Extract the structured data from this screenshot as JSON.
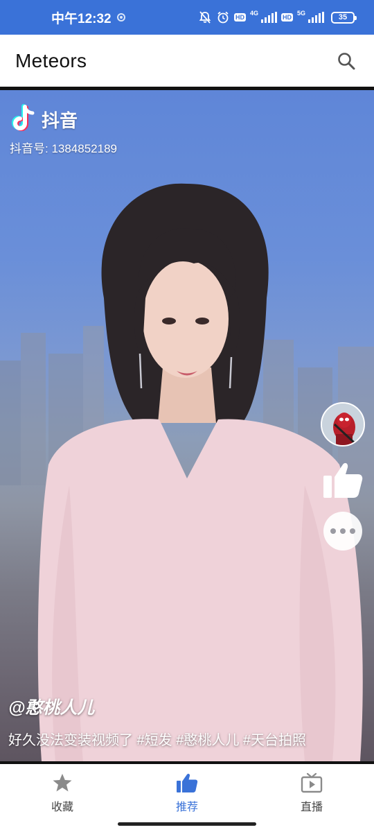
{
  "status_bar": {
    "time": "中午12:32",
    "net1": "4G",
    "net2": "5G",
    "hd": "HD",
    "battery": "35"
  },
  "app_bar": {
    "title": "Meteors"
  },
  "video": {
    "watermark_app": "抖音",
    "watermark_id": "抖音号: 1384852189",
    "author": "@憨桃人儿",
    "description": "好久没法变装视频了 #短发 #憨桃人儿 #天台拍照"
  },
  "bottom_nav": {
    "items": [
      {
        "label": "收藏",
        "icon": "star-icon",
        "active": false
      },
      {
        "label": "推荐",
        "icon": "thumbs-up-icon",
        "active": true
      },
      {
        "label": "直播",
        "icon": "tv-icon",
        "active": false
      }
    ]
  },
  "colors": {
    "accent": "#3a72d8",
    "inactive": "#8a8a8a"
  }
}
